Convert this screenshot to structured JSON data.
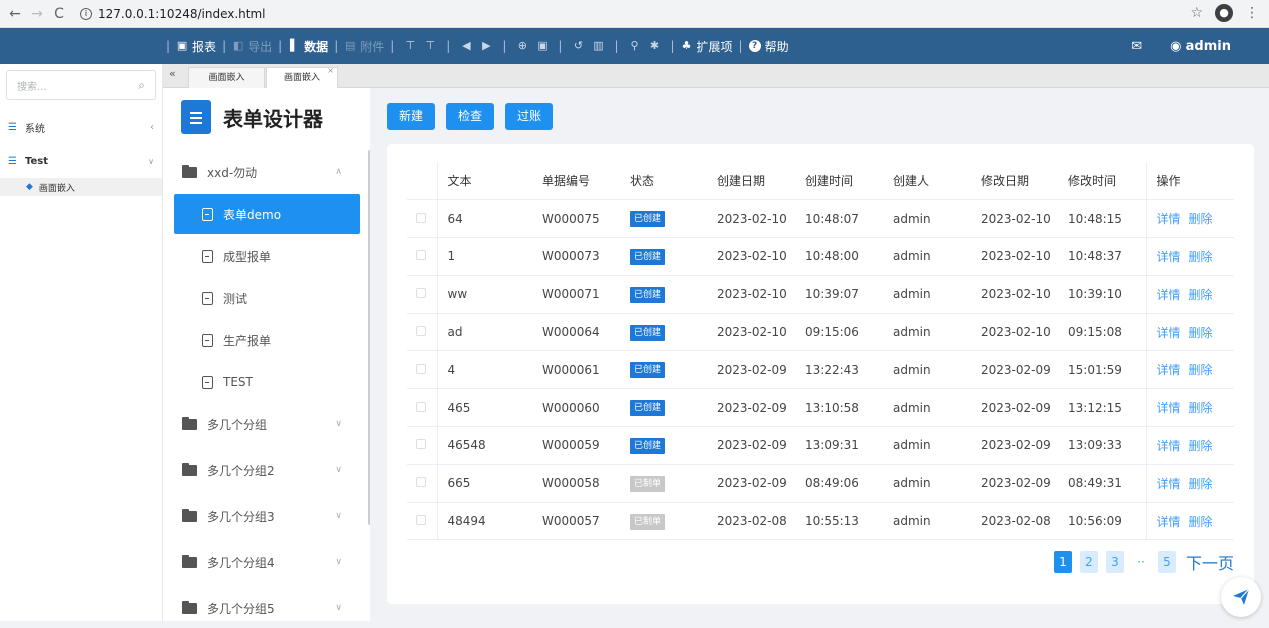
{
  "browser": {
    "url": "127.0.0.1:10248/index.html"
  },
  "toolbar": {
    "items": [
      {
        "label": "报表",
        "icon": "print-icon",
        "dim": false
      },
      {
        "label": "导出",
        "icon": "export-icon",
        "dim": true
      },
      {
        "label": "数据",
        "icon": "bar-chart-icon",
        "dim": false
      },
      {
        "label": "附件",
        "icon": "attachment-icon",
        "dim": true
      }
    ],
    "ext_label": "扩展项",
    "help_label": "帮助",
    "user": "admin"
  },
  "sidebar": {
    "search_placeholder": "搜索...",
    "items": [
      {
        "label": "系统"
      },
      {
        "label": "Test"
      }
    ],
    "sub_item": "画面嵌入"
  },
  "tabs": [
    {
      "label": "画面嵌入"
    },
    {
      "label": "画面嵌入"
    }
  ],
  "tree": {
    "title": "表单设计器",
    "group_open": "xxd-勿动",
    "leaves": [
      "表单demo",
      "成型报单",
      "测试",
      "生产报单",
      "TEST"
    ],
    "groups": [
      "多几个分组",
      "多几个分组2",
      "多几个分组3",
      "多几个分组4",
      "多几个分组5"
    ]
  },
  "actions": {
    "new": "新建",
    "check": "检查",
    "post": "过账"
  },
  "table": {
    "headers": [
      "文本",
      "单据编号",
      "状态",
      "创建日期",
      "创建时间",
      "创建人",
      "修改日期",
      "修改时间",
      "操作"
    ],
    "rows": [
      {
        "text": "64",
        "no": "W000075",
        "status": "已创建",
        "cdate": "2023-02-10",
        "ctime": "10:48:07",
        "user": "admin",
        "mdate": "2023-02-10",
        "mtime": "10:48:15"
      },
      {
        "text": "1",
        "no": "W000073",
        "status": "已创建",
        "cdate": "2023-02-10",
        "ctime": "10:48:00",
        "user": "admin",
        "mdate": "2023-02-10",
        "mtime": "10:48:37"
      },
      {
        "text": "ww",
        "no": "W000071",
        "status": "已创建",
        "cdate": "2023-02-10",
        "ctime": "10:39:07",
        "user": "admin",
        "mdate": "2023-02-10",
        "mtime": "10:39:10"
      },
      {
        "text": "ad",
        "no": "W000064",
        "status": "已创建",
        "cdate": "2023-02-10",
        "ctime": "09:15:06",
        "user": "admin",
        "mdate": "2023-02-10",
        "mtime": "09:15:08"
      },
      {
        "text": "4",
        "no": "W000061",
        "status": "已创建",
        "cdate": "2023-02-09",
        "ctime": "13:22:43",
        "user": "admin",
        "mdate": "2023-02-09",
        "mtime": "15:01:59"
      },
      {
        "text": "465",
        "no": "W000060",
        "status": "已创建",
        "cdate": "2023-02-09",
        "ctime": "13:10:58",
        "user": "admin",
        "mdate": "2023-02-09",
        "mtime": "13:12:15"
      },
      {
        "text": "46548",
        "no": "W000059",
        "status": "已创建",
        "cdate": "2023-02-09",
        "ctime": "13:09:31",
        "user": "admin",
        "mdate": "2023-02-09",
        "mtime": "13:09:33"
      },
      {
        "text": "665",
        "no": "W000058",
        "status": "已制单",
        "cdate": "2023-02-09",
        "ctime": "08:49:06",
        "user": "admin",
        "mdate": "2023-02-09",
        "mtime": "08:49:31"
      },
      {
        "text": "48494",
        "no": "W000057",
        "status": "已制单",
        "cdate": "2023-02-08",
        "ctime": "10:55:13",
        "user": "admin",
        "mdate": "2023-02-08",
        "mtime": "10:56:09"
      }
    ],
    "detail": "详情",
    "delete": "删除"
  },
  "pager": {
    "pages": [
      "1",
      "2",
      "3",
      "5"
    ],
    "dots": "··",
    "next": "下一页"
  }
}
